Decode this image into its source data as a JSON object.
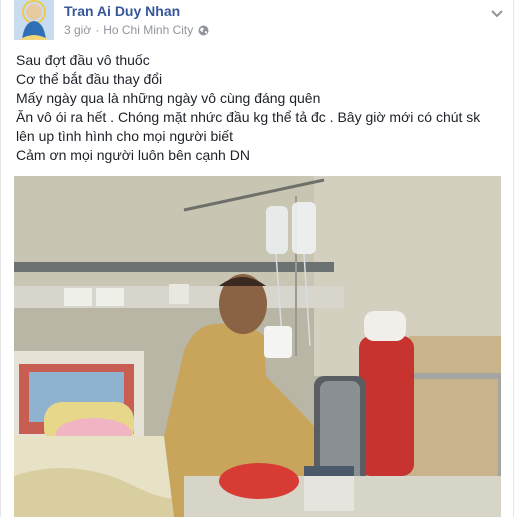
{
  "post": {
    "author": "Tran Ai Duy Nhan",
    "time": "3 giờ",
    "separator": "·",
    "location": "Ho Chi Minh City",
    "privacy_icon": "globe-icon",
    "options_icon": "chevron-down-icon",
    "lines": [
      "Sau đợt đầu vô thuốc",
      "Cơ thể bắt đầu thay đổi",
      "Mấy ngày qua là những ngày vô cùng đáng quên",
      "Ăn vô ói ra hết . Chóng mặt nhức đầu kg thể tả đc . Bây giờ mới có chút sk",
      "lên up tình hình cho mọi người biết",
      "Cảm ơn mọi người luôn bên cạnh DN"
    ]
  },
  "colors": {
    "author": "#365899",
    "meta": "#90949c",
    "text": "#1d2129"
  }
}
